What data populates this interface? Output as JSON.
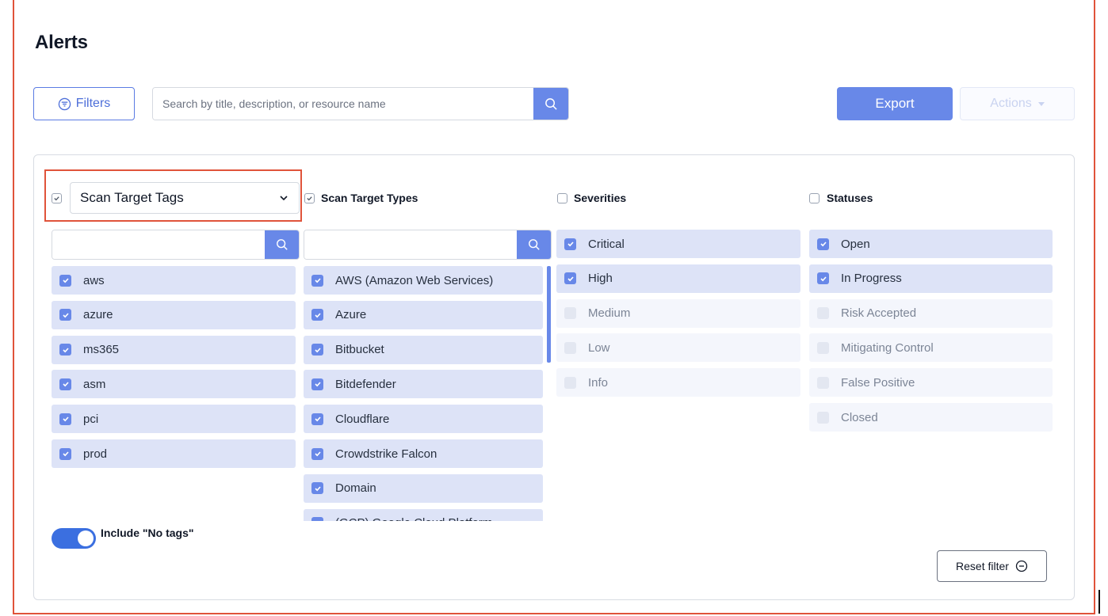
{
  "page": {
    "title": "Alerts"
  },
  "toolbar": {
    "filters_label": "Filters",
    "search_placeholder": "Search by title, description, or resource name",
    "export_label": "Export",
    "actions_label": "Actions"
  },
  "filters": {
    "tags": {
      "selected": "Scan Target Tags",
      "checked": true,
      "items": [
        {
          "label": "aws",
          "checked": true
        },
        {
          "label": "azure",
          "checked": true
        },
        {
          "label": "ms365",
          "checked": true
        },
        {
          "label": "asm",
          "checked": true
        },
        {
          "label": "pci",
          "checked": true
        },
        {
          "label": "prod",
          "checked": true
        }
      ],
      "include_no_tags_label": "Include \"No tags\"",
      "include_no_tags_on": true
    },
    "types": {
      "title": "Scan Target Types",
      "checked": true,
      "items": [
        {
          "label": "AWS (Amazon Web Services)",
          "checked": true
        },
        {
          "label": "Azure",
          "checked": true
        },
        {
          "label": "Bitbucket",
          "checked": true
        },
        {
          "label": "Bitdefender",
          "checked": true
        },
        {
          "label": "Cloudflare",
          "checked": true
        },
        {
          "label": "Crowdstrike Falcon",
          "checked": true
        },
        {
          "label": "Domain",
          "checked": true
        },
        {
          "label": "(GCP) Google Cloud Platform",
          "checked": true
        }
      ]
    },
    "severities": {
      "title": "Severities",
      "checked": false,
      "items": [
        {
          "label": "Critical",
          "checked": true
        },
        {
          "label": "High",
          "checked": true
        },
        {
          "label": "Medium",
          "checked": false
        },
        {
          "label": "Low",
          "checked": false
        },
        {
          "label": "Info",
          "checked": false
        }
      ]
    },
    "statuses": {
      "title": "Statuses",
      "checked": false,
      "items": [
        {
          "label": "Open",
          "checked": true
        },
        {
          "label": "In Progress",
          "checked": true
        },
        {
          "label": "Risk Accepted",
          "checked": false
        },
        {
          "label": "Mitigating Control",
          "checked": false
        },
        {
          "label": "False Positive",
          "checked": false
        },
        {
          "label": "Closed",
          "checked": false
        }
      ]
    },
    "reset_label": "Reset filter"
  },
  "colors": {
    "accent": "#6888e8",
    "highlight_border": "#e0533a",
    "toggle": "#3b6fe0"
  },
  "icons": {
    "filter": "filter-circle-icon",
    "search": "search-icon",
    "chevron": "chevron-down-icon",
    "reset": "minus-circle-icon",
    "check": "check-icon"
  }
}
